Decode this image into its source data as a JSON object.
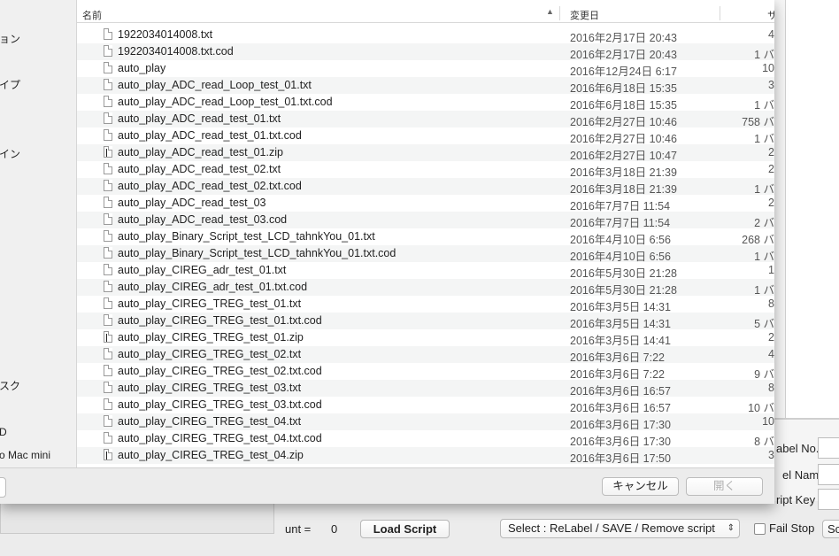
{
  "sidebar": {
    "items": [
      {
        "label": "ョン"
      },
      {
        "label": "イプ"
      },
      {
        "label": "イン"
      },
      {
        "label": "スク"
      },
      {
        "label": "D"
      },
      {
        "label": "o Mac mini"
      }
    ]
  },
  "columns": {
    "name": "名前",
    "modified": "変更日",
    "size": "サ"
  },
  "files": [
    {
      "name": "1922034014008.txt",
      "date": "2016年2月17日 20:43",
      "size": "4",
      "icon": "document-icon"
    },
    {
      "name": "1922034014008.txt.cod",
      "date": "2016年2月17日 20:43",
      "size": "1 バ",
      "icon": "document-icon"
    },
    {
      "name": "auto_play",
      "date": "2016年12月24日 6:17",
      "size": "10",
      "icon": "document-icon"
    },
    {
      "name": "auto_play_ADC_read_Loop_test_01.txt",
      "date": "2016年6月18日 15:35",
      "size": "3",
      "icon": "document-icon"
    },
    {
      "name": "auto_play_ADC_read_Loop_test_01.txt.cod",
      "date": "2016年6月18日 15:35",
      "size": "1 バ",
      "icon": "document-icon"
    },
    {
      "name": "auto_play_ADC_read_test_01.txt",
      "date": "2016年2月27日 10:46",
      "size": "758 バ",
      "icon": "document-icon"
    },
    {
      "name": "auto_play_ADC_read_test_01.txt.cod",
      "date": "2016年2月27日 10:46",
      "size": "1 バ",
      "icon": "document-icon"
    },
    {
      "name": "auto_play_ADC_read_test_01.zip",
      "date": "2016年2月27日 10:47",
      "size": "2",
      "icon": "zip-icon"
    },
    {
      "name": "auto_play_ADC_read_test_02.txt",
      "date": "2016年3月18日 21:39",
      "size": "2",
      "icon": "document-icon"
    },
    {
      "name": "auto_play_ADC_read_test_02.txt.cod",
      "date": "2016年3月18日 21:39",
      "size": "1 バ",
      "icon": "document-icon"
    },
    {
      "name": "auto_play_ADC_read_test_03",
      "date": "2016年7月7日 11:54",
      "size": "2",
      "icon": "document-icon"
    },
    {
      "name": "auto_play_ADC_read_test_03.cod",
      "date": "2016年7月7日 11:54",
      "size": "2 バ",
      "icon": "document-icon"
    },
    {
      "name": "auto_play_Binary_Script_test_LCD_tahnkYou_01.txt",
      "date": "2016年4月10日 6:56",
      "size": "268 バ",
      "icon": "document-icon"
    },
    {
      "name": "auto_play_Binary_Script_test_LCD_tahnkYou_01.txt.cod",
      "date": "2016年4月10日 6:56",
      "size": "1 バ",
      "icon": "document-icon"
    },
    {
      "name": "auto_play_CIREG_adr_test_01.txt",
      "date": "2016年5月30日 21:28",
      "size": "1",
      "icon": "document-icon"
    },
    {
      "name": "auto_play_CIREG_adr_test_01.txt.cod",
      "date": "2016年5月30日 21:28",
      "size": "1 バ",
      "icon": "document-icon"
    },
    {
      "name": "auto_play_CIREG_TREG_test_01.txt",
      "date": "2016年3月5日 14:31",
      "size": "8",
      "icon": "document-icon"
    },
    {
      "name": "auto_play_CIREG_TREG_test_01.txt.cod",
      "date": "2016年3月5日 14:31",
      "size": "5 バ",
      "icon": "document-icon"
    },
    {
      "name": "auto_play_CIREG_TREG_test_01.zip",
      "date": "2016年3月5日 14:41",
      "size": "2",
      "icon": "zip-icon"
    },
    {
      "name": "auto_play_CIREG_TREG_test_02.txt",
      "date": "2016年3月6日 7:22",
      "size": "4",
      "icon": "document-icon"
    },
    {
      "name": "auto_play_CIREG_TREG_test_02.txt.cod",
      "date": "2016年3月6日 7:22",
      "size": "9 バ",
      "icon": "document-icon"
    },
    {
      "name": "auto_play_CIREG_TREG_test_03.txt",
      "date": "2016年3月6日 16:57",
      "size": "8",
      "icon": "document-icon"
    },
    {
      "name": "auto_play_CIREG_TREG_test_03.txt.cod",
      "date": "2016年3月6日 16:57",
      "size": "10 バ",
      "icon": "document-icon"
    },
    {
      "name": "auto_play_CIREG_TREG_test_04.txt",
      "date": "2016年3月6日 17:30",
      "size": "10",
      "icon": "document-icon"
    },
    {
      "name": "auto_play_CIREG_TREG_test_04.txt.cod",
      "date": "2016年3月6日 17:30",
      "size": "8 バ",
      "icon": "document-icon"
    },
    {
      "name": "auto_play_CIREG_TREG_test_04.zip",
      "date": "2016年3月6日 17:50",
      "size": "3",
      "icon": "zip-icon"
    }
  ],
  "dialog_buttons": {
    "cancel": "キャンセル",
    "open": "開く"
  },
  "right_panel": {
    "label_no": "abel No.",
    "label_name": "el Name",
    "script_key": "ript Key"
  },
  "bottom_bar": {
    "count_label": "unt  =",
    "count_value": "0",
    "load_script": "Load Script",
    "select_value": "Select : ReLabel / SAVE / Remove script",
    "fail_stop": "Fail Stop",
    "cut_button": "Sc"
  }
}
